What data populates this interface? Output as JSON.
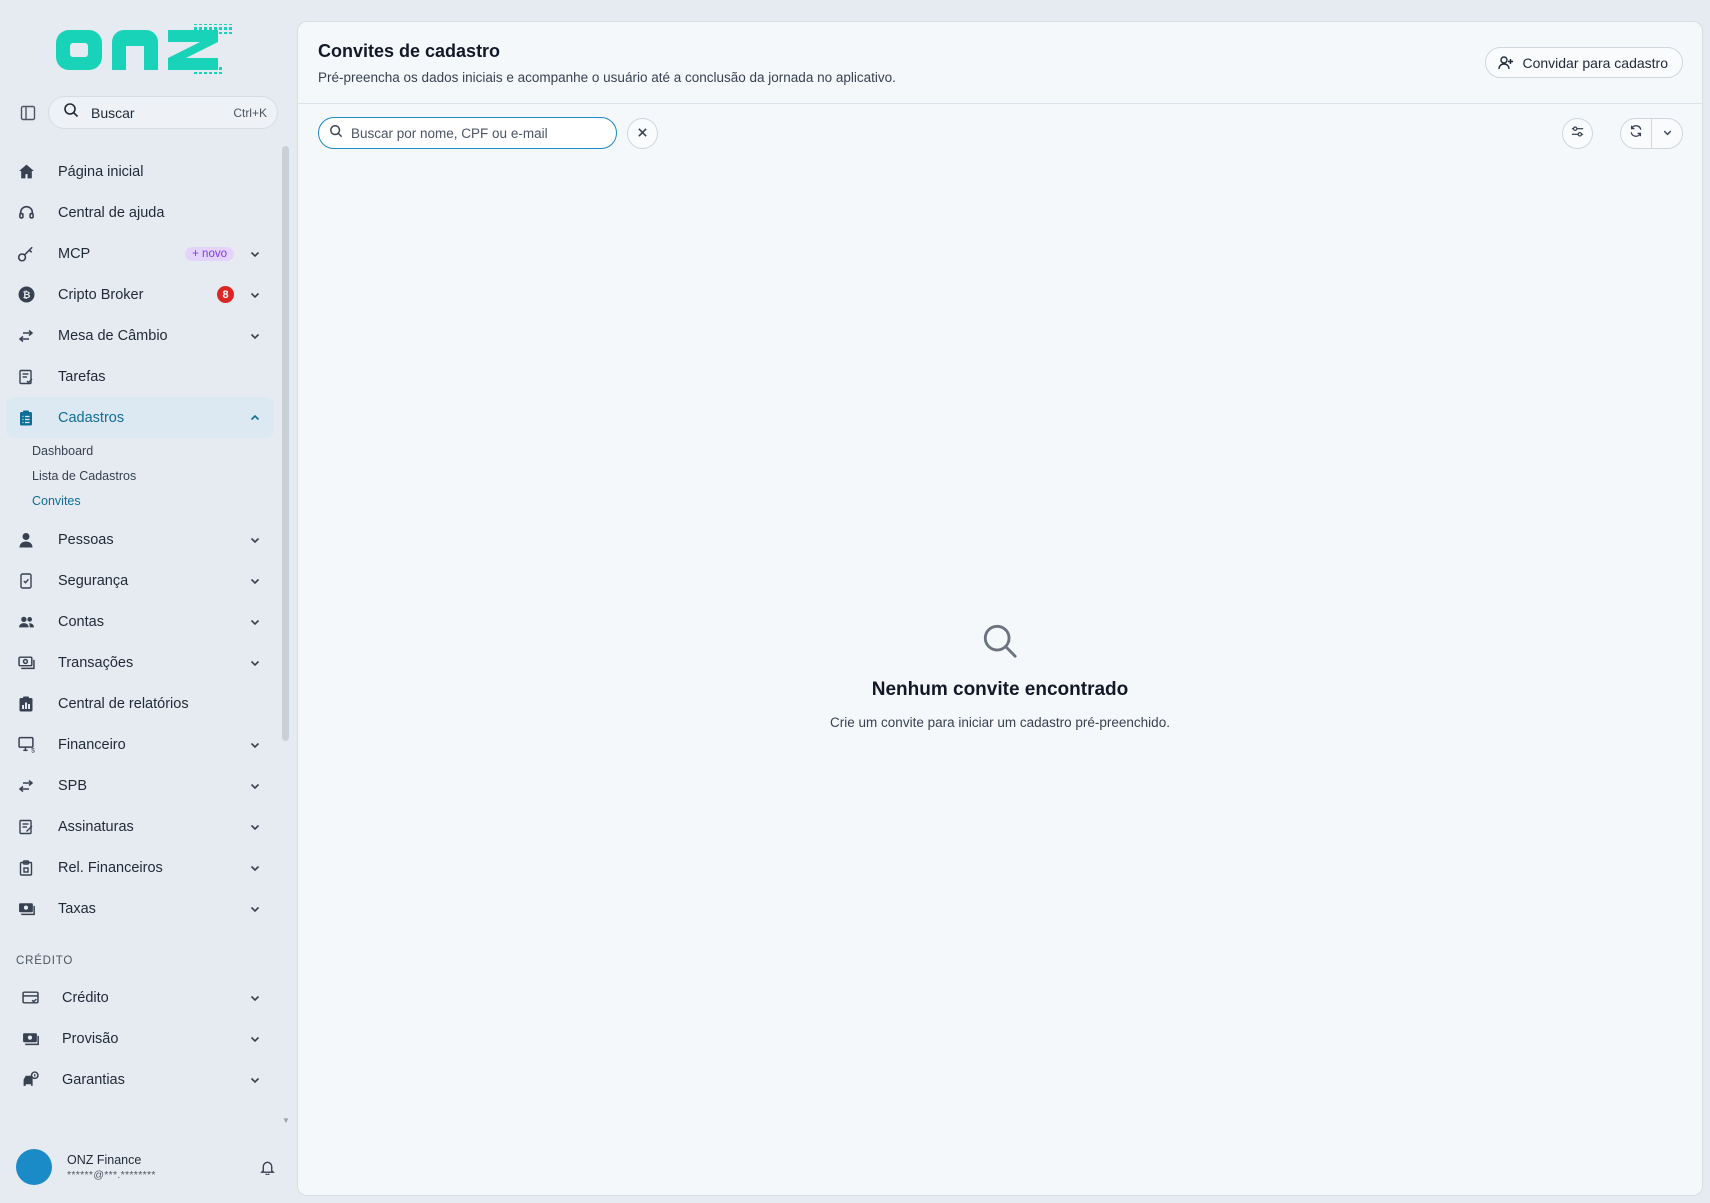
{
  "brand": {
    "logo_text": "onz",
    "accent": "#19d3b8"
  },
  "sidebar": {
    "search": {
      "label": "Buscar",
      "shortcut": "Ctrl+K"
    },
    "items": [
      {
        "label": "Página inicial",
        "icon": "home-icon"
      },
      {
        "label": "Central de ajuda",
        "icon": "headset-icon"
      },
      {
        "label": "MCP",
        "icon": "key-icon",
        "badge": "+ novo"
      },
      {
        "label": "Cripto Broker",
        "icon": "bitcoin-icon",
        "badge": "8"
      },
      {
        "label": "Mesa de Câmbio",
        "icon": "exchange-icon"
      },
      {
        "label": "Tarefas",
        "icon": "task-icon"
      },
      {
        "label": "Cadastros",
        "icon": "clipboard-icon"
      },
      {
        "label": "Pessoas",
        "icon": "person-icon"
      },
      {
        "label": "Segurança",
        "icon": "shield-phone-icon"
      },
      {
        "label": "Contas",
        "icon": "people-icon"
      },
      {
        "label": "Transações",
        "icon": "money-icon"
      },
      {
        "label": "Central de relatórios",
        "icon": "report-icon"
      },
      {
        "label": "Financeiro",
        "icon": "finance-icon"
      },
      {
        "label": "SPB",
        "icon": "transfer-icon"
      },
      {
        "label": "Assinaturas",
        "icon": "signature-icon"
      },
      {
        "label": "Rel. Financeiros",
        "icon": "clipboard-report-icon"
      },
      {
        "label": "Taxas",
        "icon": "fees-icon"
      }
    ],
    "cadastros_sub": [
      {
        "label": "Dashboard"
      },
      {
        "label": "Lista de Cadastros"
      },
      {
        "label": "Convites"
      }
    ],
    "credit_section": {
      "title": "CRÉDITO",
      "items": [
        {
          "label": "Crédito",
          "icon": "card-icon"
        },
        {
          "label": "Provisão",
          "icon": "provision-icon"
        },
        {
          "label": "Garantias",
          "icon": "guarantee-icon"
        }
      ]
    },
    "user": {
      "name": "ONZ Finance",
      "email": "******@***.********"
    }
  },
  "main": {
    "title": "Convites de cadastro",
    "subtitle": "Pré-preencha os dados iniciais e acompanhe o usuário até a conclusão da jornada no aplicativo.",
    "invite_button": "Convidar para cadastro",
    "search_placeholder": "Buscar por nome, CPF ou e-mail",
    "search_value": "",
    "empty": {
      "title": "Nenhum convite encontrado",
      "text": "Crie um convite para iniciar um cadastro pré-preenchido."
    }
  }
}
